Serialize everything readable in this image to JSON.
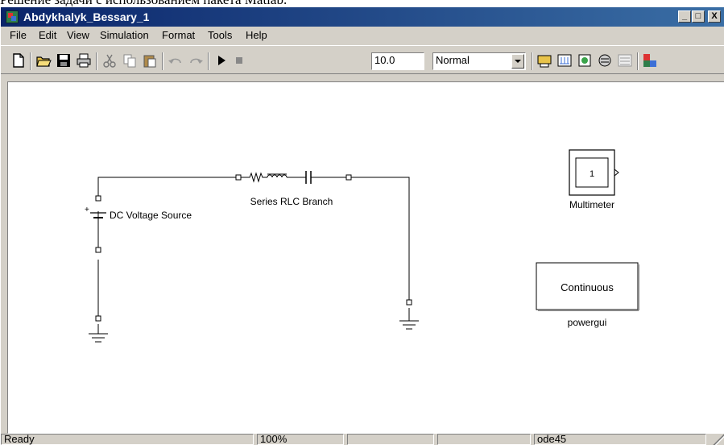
{
  "doc_text": "Решение задачи с использованием пакета Matlab.",
  "window": {
    "title": "Abdykhalyk_Bessary_1"
  },
  "title_buttons": {
    "minimize": "_",
    "maximize": "□",
    "close": "X"
  },
  "menu": [
    "File",
    "Edit",
    "View",
    "Simulation",
    "Format",
    "Tools",
    "Help"
  ],
  "toolbar": {
    "stop_time": "10.0",
    "sim_mode": "Normal"
  },
  "model": {
    "rlc_label": "Series RLC Branch",
    "dc_label": "DC Voltage Source",
    "dc_plus": "+",
    "multimeter_value": "1",
    "multimeter_label": "Multimeter",
    "powergui_text": "Continuous",
    "powergui_label": "powergui"
  },
  "status": {
    "state": "Ready",
    "zoom": "100%",
    "solver": "ode45"
  },
  "colors": {
    "titlebar_start": "#0a246a",
    "titlebar_end": "#3a6ea5",
    "face": "#d4d0c8"
  }
}
